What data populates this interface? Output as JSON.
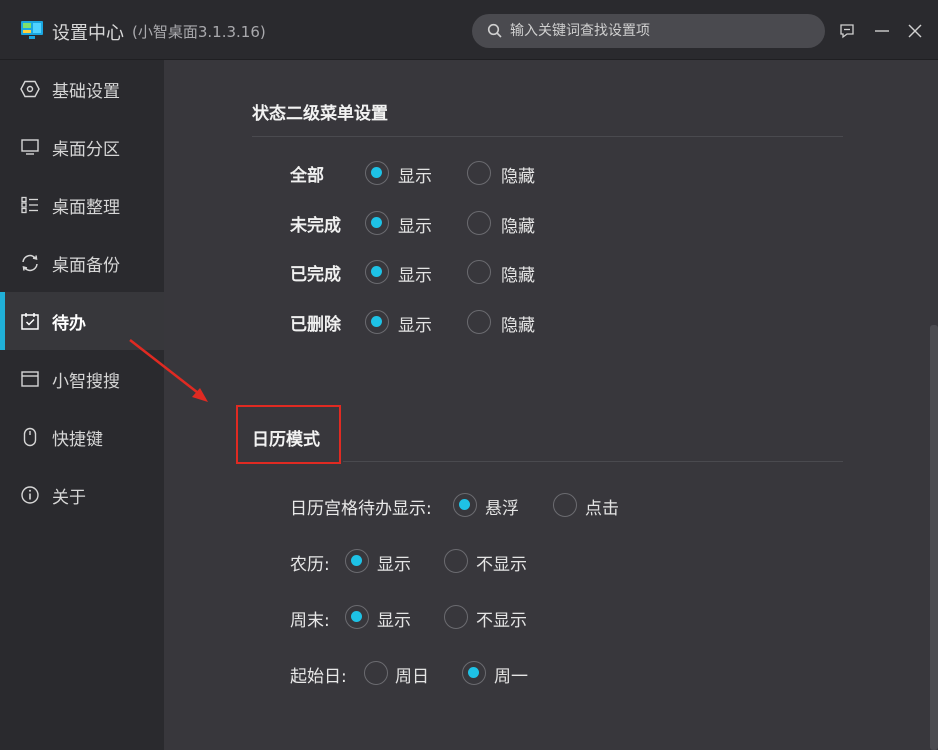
{
  "window": {
    "title": "设置中心",
    "version": "(小智桌面3.1.3.16)",
    "search_placeholder": "输入关键词查找设置项"
  },
  "sidebar": {
    "items": [
      {
        "label": "基础设置",
        "icon": "hexagon-settings-icon",
        "active": false
      },
      {
        "label": "桌面分区",
        "icon": "monitor-icon",
        "active": false
      },
      {
        "label": "桌面整理",
        "icon": "list-icon",
        "active": false
      },
      {
        "label": "桌面备份",
        "icon": "backup-sync-icon",
        "active": false
      },
      {
        "label": "待办",
        "icon": "calendar-check-icon",
        "active": true
      },
      {
        "label": "小智搜搜",
        "icon": "window-icon",
        "active": false
      },
      {
        "label": "快捷键",
        "icon": "mouse-icon",
        "active": false
      },
      {
        "label": "关于",
        "icon": "info-icon",
        "active": false
      }
    ]
  },
  "status_menu": {
    "title": "状态二级菜单设置",
    "show_label": "显示",
    "hide_label": "隐藏",
    "rows": [
      {
        "label": "全部",
        "selected": "显示"
      },
      {
        "label": "未完成",
        "selected": "显示"
      },
      {
        "label": "已完成",
        "selected": "显示"
      },
      {
        "label": "已删除",
        "selected": "显示"
      }
    ]
  },
  "calendar_mode": {
    "title": "日历模式",
    "grid_display": {
      "label": "日历宫格待办显示:",
      "options": [
        "悬浮",
        "点击"
      ],
      "selected": "悬浮"
    },
    "lunar": {
      "label": "农历:",
      "options": [
        "显示",
        "不显示"
      ],
      "selected": "显示"
    },
    "weekend": {
      "label": "周末:",
      "options": [
        "显示",
        "不显示"
      ],
      "selected": "显示"
    },
    "week_start": {
      "label": "起始日:",
      "options": [
        "周日",
        "周一"
      ],
      "selected": "周一"
    }
  },
  "colors": {
    "accent": "#1ec2e6",
    "active_bar": "#20b0d8",
    "annotation_red": "#e02a22"
  }
}
